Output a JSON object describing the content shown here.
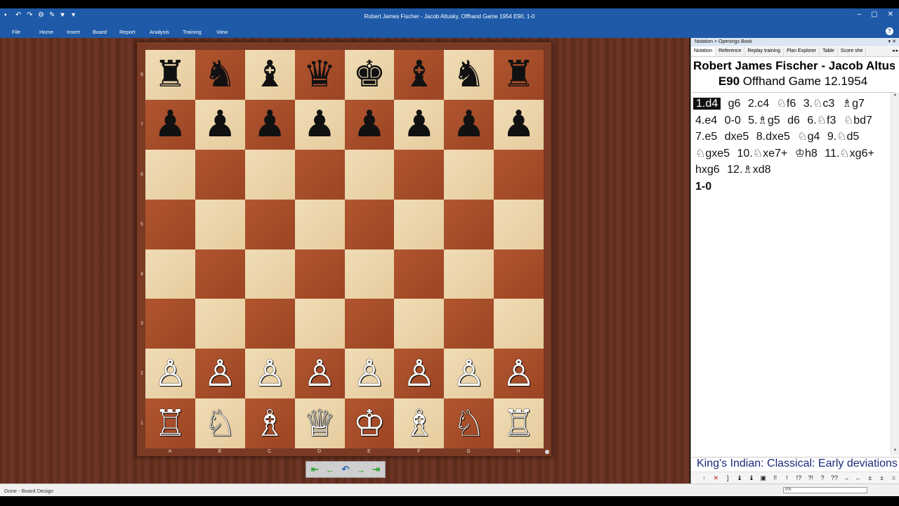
{
  "window": {
    "title": "Robert James Fischer - Jacob Altusky, Offhand Game 1954  E90, 1-0",
    "controls": [
      "–",
      "▢",
      "✕"
    ]
  },
  "menu": [
    "File",
    "Home",
    "Insert",
    "Board",
    "Report",
    "Analysis",
    "Training",
    "View"
  ],
  "board": {
    "ranks": [
      "8",
      "7",
      "6",
      "5",
      "4",
      "3",
      "2",
      "1"
    ],
    "files": [
      "A",
      "B",
      "C",
      "D",
      "E",
      "F",
      "G",
      "H"
    ],
    "position": [
      [
        "♜",
        "♞",
        "♝",
        "♛",
        "♚",
        "♝",
        "♞",
        "♜"
      ],
      [
        "♟",
        "♟",
        "♟",
        "♟",
        "♟",
        "♟",
        "♟",
        "♟"
      ],
      [
        "",
        "",
        "",
        "",
        "",
        "",
        "",
        ""
      ],
      [
        "",
        "",
        "",
        "",
        "",
        "",
        "",
        ""
      ],
      [
        "",
        "",
        "",
        "",
        "",
        "",
        "",
        ""
      ],
      [
        "",
        "",
        "",
        "",
        "",
        "",
        "",
        ""
      ],
      [
        "♙",
        "♙",
        "♙",
        "♙",
        "♙",
        "♙",
        "♙",
        "♙"
      ],
      [
        "♖",
        "♘",
        "♗",
        "♕",
        "♔",
        "♗",
        "♘",
        "♖"
      ]
    ]
  },
  "nav_buttons": [
    "⇤",
    "←",
    "↶",
    "→",
    "⇥"
  ],
  "panel": {
    "title": "Notation + Openings Book",
    "tabs": [
      "Notation",
      "Reference",
      "Replay training",
      "Plan Explorer",
      "Table",
      "Score she"
    ],
    "players": "Robert James Fischer - Jacob Altusky",
    "eco": "E90",
    "event": "Offhand Game 12.1954",
    "moves": [
      "1.d4",
      "g6",
      "2.c4",
      "♘f6",
      "3.♘c3",
      "♗g7",
      "4.e4",
      "0-0",
      "5.♗g5",
      "d6",
      "6.♘f3",
      "♘bd7",
      "7.e5",
      "dxe5",
      "8.dxe5",
      "♘g4",
      "9.♘d5",
      "♘gxe5",
      "10.♘xe7+",
      "♔h8",
      "11.♘xg6+",
      "hxg6",
      "12.♗xd8"
    ],
    "result": "1-0",
    "opening": "King's Indian: Classical: Early deviations",
    "symbols": [
      "↑",
      "✕",
      "]",
      "♝",
      "♝",
      "▣",
      "!!",
      "!",
      "!?",
      "?!",
      "?",
      "??",
      "→",
      "←",
      "±",
      "±",
      "="
    ]
  },
  "status": {
    "text": "Done - Board Design",
    "progress": "0%"
  }
}
